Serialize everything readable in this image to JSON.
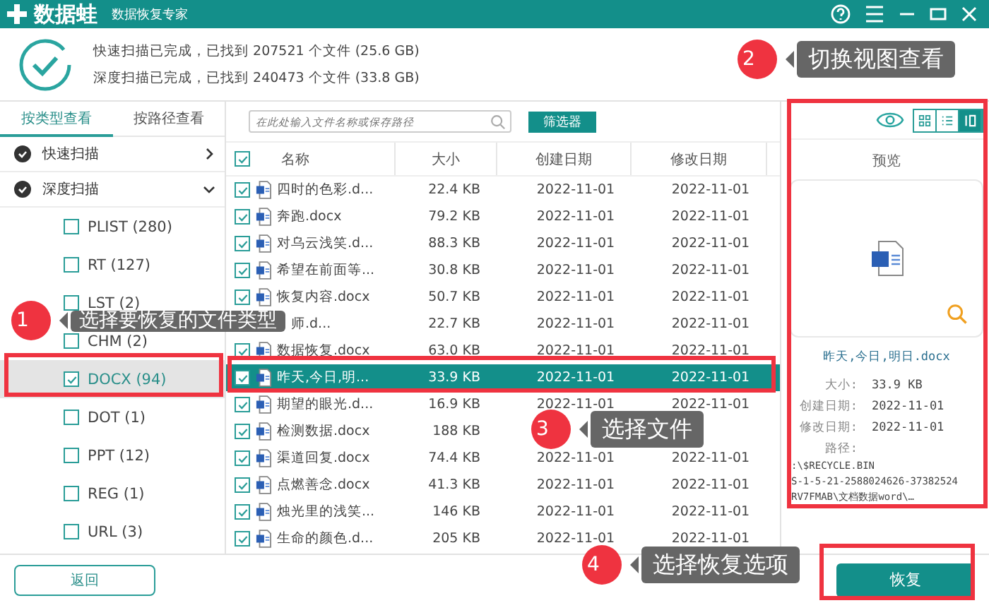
{
  "title_bar": {
    "app_name": "数据蛙",
    "subtitle": "数据恢复专家"
  },
  "scan_summary": [
    "快速扫描已完成，已找到 207521 个文件 (25.6 GB)",
    "深度扫描已完成，已找到 240473 个文件 (33.8 GB)"
  ],
  "tabs": [
    {
      "label": "按类型查看",
      "selected": true
    },
    {
      "label": "按路径查看",
      "selected": false
    }
  ],
  "tree": [
    {
      "label": "快速扫描",
      "checked": true,
      "expanded": false
    },
    {
      "label": "深度扫描",
      "checked": true,
      "expanded": true,
      "children": [
        {
          "label": "PLIST (280)",
          "checked": false,
          "selected": false
        },
        {
          "label": "RT (127)",
          "checked": false,
          "selected": false
        },
        {
          "label": "LST (2)",
          "checked": false,
          "selected": false
        },
        {
          "label": "CHM (2)",
          "checked": false,
          "selected": false
        },
        {
          "label": "DOCX (94)",
          "checked": true,
          "selected": true
        },
        {
          "label": "DOT (1)",
          "checked": false,
          "selected": false
        },
        {
          "label": "PPT (12)",
          "checked": false,
          "selected": false
        },
        {
          "label": "REG (1)",
          "checked": false,
          "selected": false
        },
        {
          "label": "URL (3)",
          "checked": false,
          "selected": false
        }
      ]
    }
  ],
  "search": {
    "placeholder": "在此处输入文件名称或保存路径"
  },
  "filter_button": "筛选器",
  "table": {
    "all_checked": true,
    "columns": [
      "名称",
      "大小",
      "创建日期",
      "修改日期"
    ],
    "rows": [
      {
        "name": "四时的色彩.d...",
        "size": "22.4 KB",
        "created": "2022-11-01",
        "modified": "2022-11-01",
        "checked": true,
        "selected": false
      },
      {
        "name": "奔跑.docx",
        "size": "79.2 KB",
        "created": "2022-11-01",
        "modified": "2022-11-01",
        "checked": true,
        "selected": false
      },
      {
        "name": "对乌云浅笑.d...",
        "size": "88.3 KB",
        "created": "2022-11-01",
        "modified": "2022-11-01",
        "checked": true,
        "selected": false
      },
      {
        "name": "希望在前面等...",
        "size": "30.8 KB",
        "created": "2022-11-01",
        "modified": "2022-11-01",
        "checked": true,
        "selected": false
      },
      {
        "name": "恢复内容.docx",
        "size": "50.7 KB",
        "created": "2022-11-01",
        "modified": "2022-11-01",
        "checked": true,
        "selected": false
      },
      {
        "name": "师.d...",
        "size": "22.7 KB",
        "created": "2022-11-01",
        "modified": "2022-11-01",
        "covered": true,
        "selected": false
      },
      {
        "name": "数据恢复.docx",
        "size": "63.0 KB",
        "created": "2022-11-01",
        "modified": "2022-11-01",
        "checked": true,
        "selected": false
      },
      {
        "name": "昨天,今日,明...",
        "size": "33.9 KB",
        "created": "2022-11-01",
        "modified": "2022-11-01",
        "checked": true,
        "selected": true
      },
      {
        "name": "期望的眼光.d...",
        "size": "16.9 KB",
        "created": "2022-11-01",
        "modified": "2022-11-01",
        "checked": true,
        "selected": false
      },
      {
        "name": "检测数据.docx",
        "size": "188 KB",
        "checked": true,
        "selected": false
      },
      {
        "name": "渠道回复.docx",
        "size": "74.4 KB",
        "created": "2022-11-01",
        "modified": "2022-11-01",
        "checked": true,
        "selected": false
      },
      {
        "name": "点燃善念.docx",
        "size": "41.3 KB",
        "created": "2022-11-01",
        "modified": "2022-11-01",
        "checked": true,
        "selected": false
      },
      {
        "name": "烛光里的浅笑...",
        "size": "146 KB",
        "created": "2022-11-01",
        "modified": "2022-11-01",
        "checked": true,
        "selected": false
      },
      {
        "name": "生命的颜色.d...",
        "size": "205 KB",
        "created": "2022-11-01",
        "modified": "2022-11-01",
        "checked": true,
        "selected": false
      }
    ]
  },
  "view_modes": [
    {
      "kind": "grid",
      "selected": false
    },
    {
      "kind": "list",
      "selected": false
    },
    {
      "kind": "preview",
      "selected": true
    }
  ],
  "preview": {
    "title": "预览",
    "file_name": "昨天,今日,明日.docx",
    "details": [
      {
        "label": "大小:",
        "value": "33.9 KB"
      },
      {
        "label": "创建日期:",
        "value": "2022-11-01"
      },
      {
        "label": "修改日期:",
        "value": "2022-11-01"
      }
    ],
    "path_label": "路径:",
    "path_lines": [
      ":\\$RECYCLE.BIN",
      "S-1-5-21-2588024626-37382524",
      "RV7FMAB\\文档数据word\\…"
    ]
  },
  "back_button": "返回",
  "recover_button": "恢复",
  "callouts": [
    {
      "number": "1",
      "text": "选择要恢复的文件类型"
    },
    {
      "number": "2",
      "text": "切换视图查看"
    },
    {
      "number": "3",
      "text": "选择文件"
    },
    {
      "number": "4",
      "text": "选择恢复选项"
    }
  ]
}
